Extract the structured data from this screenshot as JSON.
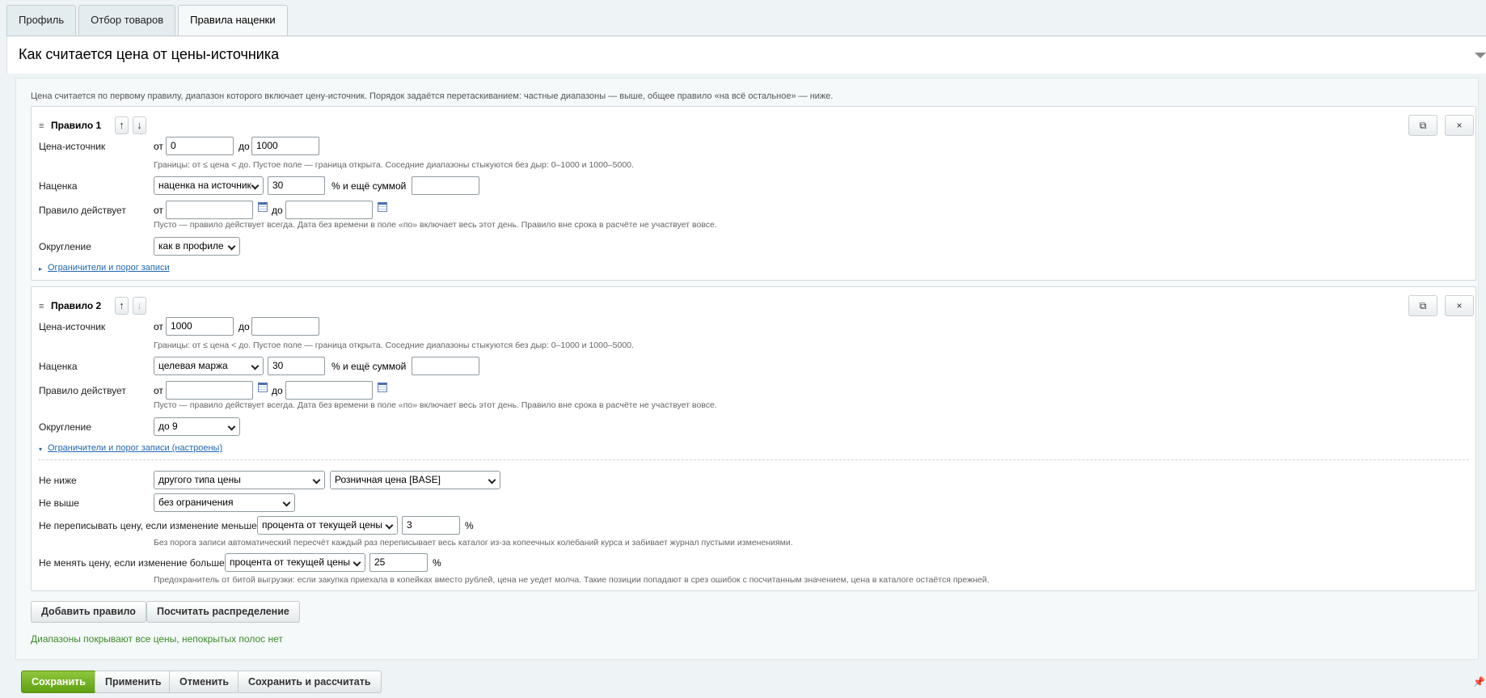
{
  "tabs": [
    {
      "label": "Профиль"
    },
    {
      "label": "Отбор товаров"
    },
    {
      "label": "Правила наценки",
      "active": true
    }
  ],
  "section": {
    "title": "Как считается цена от цены-источника"
  },
  "hint_top": "Цена считается по первому правилу, диапазон которого включает цену-источник. Порядок задаётся перетаскиванием: частные диапазоны — выше, общее правило «на всё остальное» — ниже.",
  "icons": {
    "drag": "≡",
    "up": "↑",
    "down": "↓",
    "copy": "⧉",
    "close": "×",
    "pin": "pin-icon"
  },
  "labels": {
    "source_price": "Цена-источник",
    "from": "от",
    "to": "до",
    "markup": "Наценка",
    "percent_and_sum": "% и ещё суммой",
    "active_period": "Правило действует",
    "rounding": "Округление",
    "hint_bounds": "Границы: от ≤ цена < до. Пустое поле — граница открыта. Соседние диапазоны стыкуются без дыр: 0–1000 и 1000–5000.",
    "hint_period": "Пусто — правило действует всегда. Дата без времени в поле «по» включает весь этот день. Правило вне срока в расчёте не участвует вовсе.",
    "percent": "%"
  },
  "rules": [
    {
      "title": "Правило 1",
      "from": "0",
      "to": "1000",
      "markup_type": "наценка на источник",
      "markup_percent": "30",
      "markup_sum": "",
      "date_from": "",
      "date_to": "",
      "rounding": "как в профиле",
      "limits_link": "Ограничители и порог записи"
    },
    {
      "title": "Правило 2",
      "from": "1000",
      "to": "",
      "markup_type": "целевая маржа",
      "markup_percent": "30",
      "markup_sum": "",
      "date_from": "",
      "date_to": "",
      "rounding": "до 9",
      "limits_link": "Ограничители и порог записи (настроены)",
      "limits": {
        "not_lower_label": "Не ниже",
        "not_lower_type": "другого типа цены",
        "not_lower_price": "Розничная цена [BASE]",
        "not_higher_label": "Не выше",
        "not_higher_type": "без ограничения",
        "no_rewrite_label": "Не переписывать цену, если изменение меньше",
        "no_rewrite_type": "процента от текущей цены",
        "no_rewrite_value": "3",
        "no_rewrite_hint": "Без порога записи автоматический пересчёт каждый раз переписывает весь каталог из-за копеечных колебаний курса и забивает журнал пустыми изменениями.",
        "no_change_label": "Не менять цену, если изменение больше",
        "no_change_type": "процента от текущей цены",
        "no_change_value": "25",
        "no_change_hint": "Предохранитель от битой выгрузки: если закупка приехала в копейках вместо рублей, цена не уедет молча. Такие позиции попадают в срез ошибок с посчитанным значением, цена в каталоге остаётся прежней."
      }
    }
  ],
  "actions": {
    "add_rule": "Добавить правило",
    "calc_distribution": "Посчитать распределение"
  },
  "status": "Диапазоны покрывают все цены, непокрытых полос нет",
  "colors": {
    "status_ok": "#3a8a2a",
    "save_green": "#6aab1c",
    "link": "#2067b0"
  },
  "footer": {
    "save": "Сохранить",
    "apply": "Применить",
    "cancel": "Отменить",
    "save_calc": "Сохранить и рассчитать"
  }
}
